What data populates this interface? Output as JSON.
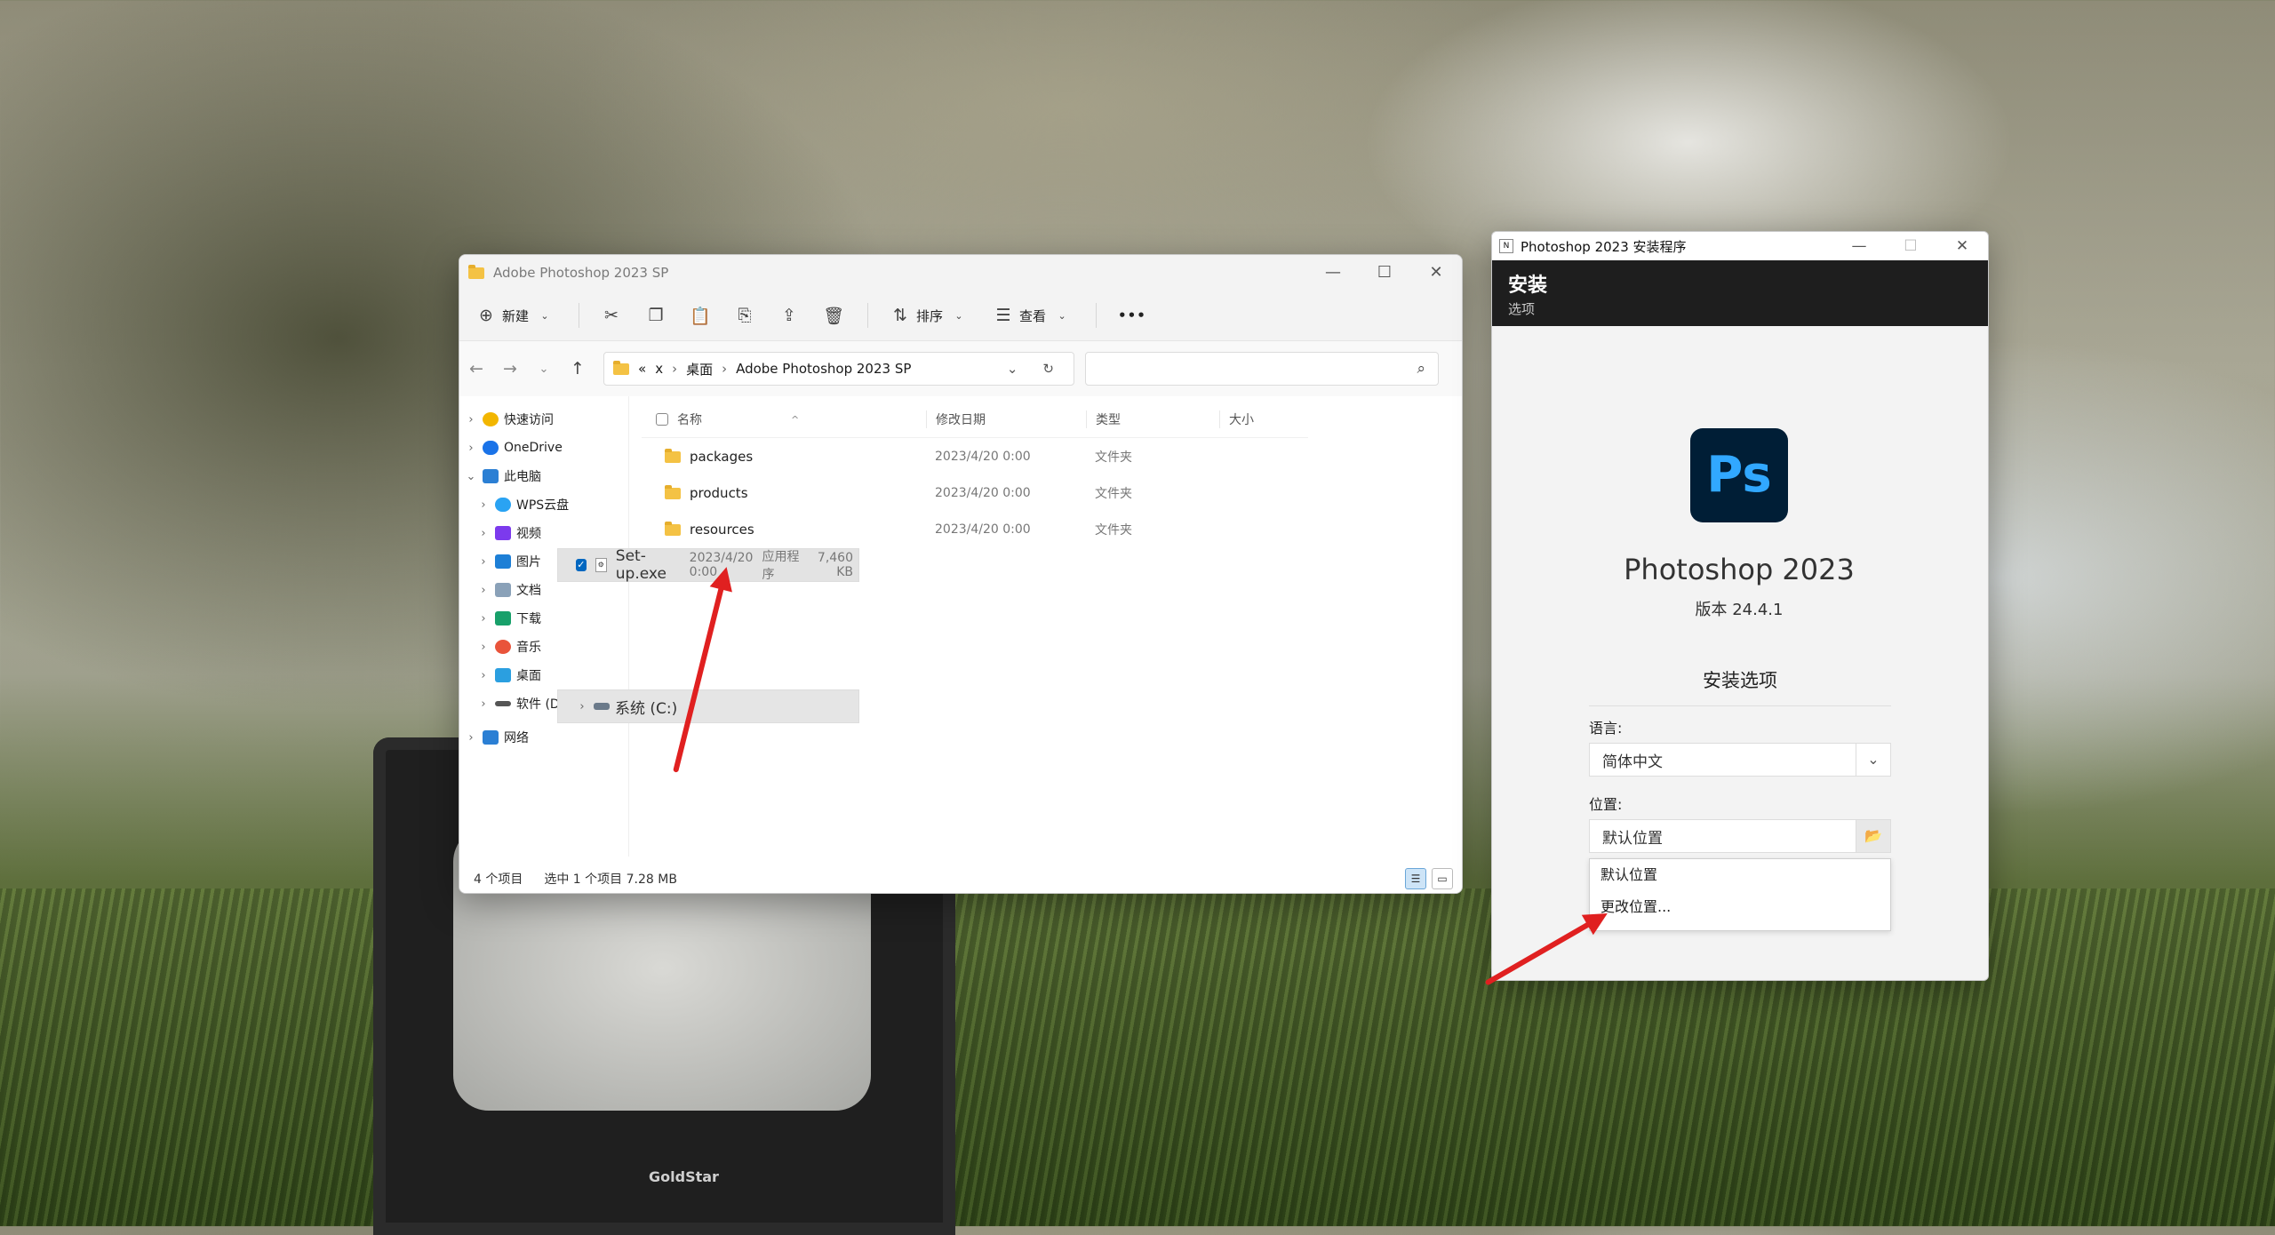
{
  "explorer": {
    "title": "Adobe Photoshop 2023 SP",
    "toolbar": {
      "new": "新建",
      "sort": "排序",
      "view": "查看",
      "more": "•••"
    },
    "breadcrumb": [
      "«",
      "x",
      "桌面",
      "Adobe Photoshop 2023 SP"
    ],
    "nav": [
      {
        "label": "快速访问",
        "color": "#f2b600"
      },
      {
        "label": "OneDrive",
        "color": "#1a73e8"
      },
      {
        "label": "此电脑",
        "color": "#2b7fd4"
      },
      {
        "label": "WPS云盘",
        "color": "#2aa3f3"
      },
      {
        "label": "视频",
        "color": "#7c3aed"
      },
      {
        "label": "图片",
        "color": "#1d7fd6"
      },
      {
        "label": "文档",
        "color": "#8aa1b8"
      },
      {
        "label": "下载",
        "color": "#18a06a"
      },
      {
        "label": "音乐",
        "color": "#e9543b"
      },
      {
        "label": "桌面",
        "color": "#2b9fe0"
      },
      {
        "label": "系统 (C:)",
        "color": "#6b7a8a"
      },
      {
        "label": "软件 (D:)",
        "color": "#555555"
      },
      {
        "label": "网络",
        "color": "#2b7fd4"
      }
    ],
    "columns": {
      "name": "名称",
      "date": "修改日期",
      "type": "类型",
      "size": "大小"
    },
    "files": [
      {
        "name": "packages",
        "date": "2023/4/20 0:00",
        "type": "文件夹",
        "size": ""
      },
      {
        "name": "products",
        "date": "2023/4/20 0:00",
        "type": "文件夹",
        "size": ""
      },
      {
        "name": "resources",
        "date": "2023/4/20 0:00",
        "type": "文件夹",
        "size": ""
      },
      {
        "name": "Set-up.exe",
        "date": "2023/4/20 0:00",
        "type": "应用程序",
        "size": "7,460 KB"
      }
    ],
    "status": {
      "count": "4 个项目",
      "selection": "选中 1 个项目  7.28 MB"
    }
  },
  "installer": {
    "title": "Photoshop 2023 安装程序",
    "header_title": "安装",
    "header_subtitle": "选项",
    "logo_text": "Ps",
    "product_name": "Photoshop 2023",
    "version": "版本 24.4.1",
    "options_title": "安装选项",
    "language_label": "语言:",
    "language_value": "简体中文",
    "location_label": "位置:",
    "location_value": "默认位置",
    "dropdown_options": [
      "默认位置",
      "更改位置..."
    ]
  },
  "colors": {
    "accent": "#0067c0",
    "ps_bg": "#001e36",
    "ps_fg": "#31a8ff",
    "arrow": "#e02020"
  }
}
